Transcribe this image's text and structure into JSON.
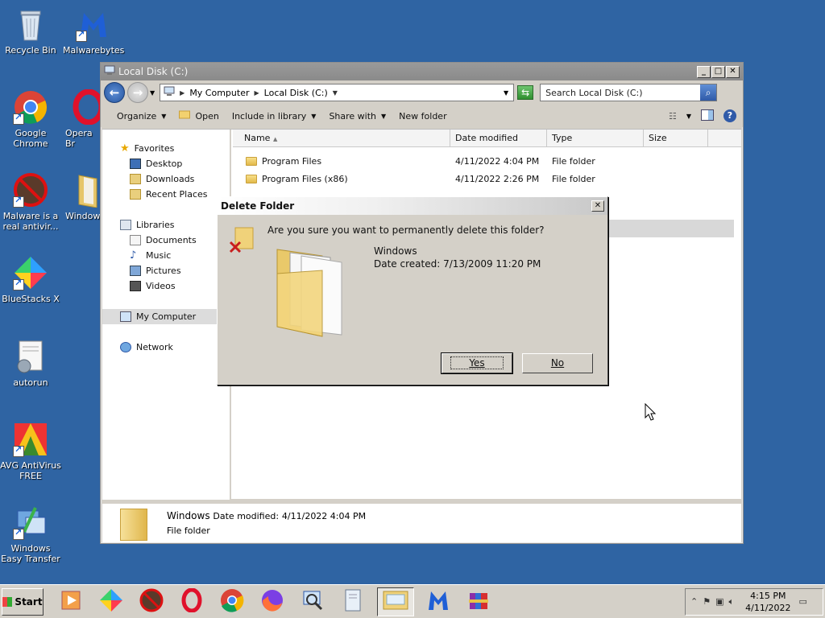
{
  "desktop": {
    "icons": [
      {
        "label": "Recycle Bin",
        "icon": "recycle-bin-icon"
      },
      {
        "label": "Malwarebytes",
        "icon": "malwarebytes-icon"
      },
      {
        "label": "Google Chrome",
        "icon": "chrome-icon"
      },
      {
        "label": "Opera Br",
        "icon": "opera-icon"
      },
      {
        "label": "Malware is a real antivir...",
        "icon": "malware-icon"
      },
      {
        "label": "Windows",
        "icon": "folder-icon"
      },
      {
        "label": "BlueStacks X",
        "icon": "bluestacks-icon"
      },
      {
        "label": "autorun",
        "icon": "autorun-icon"
      },
      {
        "label": "AVG AntiVirus FREE",
        "icon": "avg-icon"
      },
      {
        "label": "Windows Easy Transfer",
        "icon": "easy-transfer-icon"
      }
    ]
  },
  "explorer": {
    "title": "Local Disk (C:)",
    "address": {
      "crumbs": [
        "My Computer",
        "Local Disk (C:)"
      ]
    },
    "search_placeholder": "Search Local Disk (C:)",
    "toolbar": {
      "organize": "Organize",
      "open": "Open",
      "include_in_library": "Include in library",
      "share_with": "Share with",
      "new_folder": "New folder"
    },
    "nav": {
      "favorites": "Favorites",
      "desktop": "Desktop",
      "downloads": "Downloads",
      "recent_places": "Recent Places",
      "libraries": "Libraries",
      "documents": "Documents",
      "music": "Music",
      "pictures": "Pictures",
      "videos": "Videos",
      "my_computer": "My Computer",
      "network": "Network"
    },
    "columns": {
      "name": "Name",
      "date_modified": "Date modified",
      "type": "Type",
      "size": "Size"
    },
    "files": [
      {
        "name": "Program Files",
        "date": "4/11/2022 4:04 PM",
        "type": "File folder"
      },
      {
        "name": "Program Files (x86)",
        "date": "4/11/2022 2:26 PM",
        "type": "File folder"
      }
    ],
    "details": {
      "name": "Windows",
      "meta_label": "Date modified:",
      "meta_value": "4/11/2022 4:04 PM",
      "type": "File folder"
    }
  },
  "dialog": {
    "title": "Delete Folder",
    "question": "Are you sure you want to permanently delete this folder?",
    "item_name": "Windows",
    "item_date": "Date created: 7/13/2009 11:20 PM",
    "yes": "Yes",
    "no": "No"
  },
  "taskbar": {
    "start": "Start",
    "time": "4:15 PM",
    "date": "4/11/2022"
  }
}
